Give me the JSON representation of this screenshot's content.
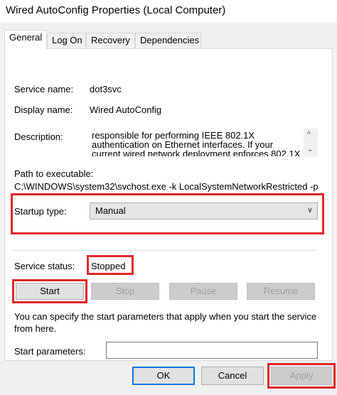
{
  "window": {
    "title": "Wired AutoConfig Properties (Local Computer)"
  },
  "tabs": [
    {
      "label": "General"
    },
    {
      "label": "Log On"
    },
    {
      "label": "Recovery"
    },
    {
      "label": "Dependencies"
    }
  ],
  "general": {
    "service_name_label": "Service name:",
    "service_name": "dot3svc",
    "display_name_label": "Display name:",
    "display_name": "Wired AutoConfig",
    "description_label": "Description:",
    "description": "responsible for performing IEEE 802.1X authentication on Ethernet interfaces. If your current wired network deployment enforces 802.1X",
    "path_label": "Path to executable:",
    "path": "C:\\WINDOWS\\system32\\svchost.exe -k LocalSystemNetworkRestricted -p",
    "startup_type_label": "Startup type:",
    "startup_type": "Manual",
    "service_status_label": "Service status:",
    "service_status": "Stopped",
    "buttons": {
      "start": "Start",
      "stop": "Stop",
      "pause": "Pause",
      "resume": "Resume"
    },
    "hint": "You can specify the start parameters that apply when you start the service from here.",
    "start_params_label": "Start parameters:",
    "start_params_value": ""
  },
  "footer": {
    "ok": "OK",
    "cancel": "Cancel",
    "apply": "Apply"
  },
  "colors": {
    "highlight": "#e0262a",
    "focus": "#0078d7"
  }
}
